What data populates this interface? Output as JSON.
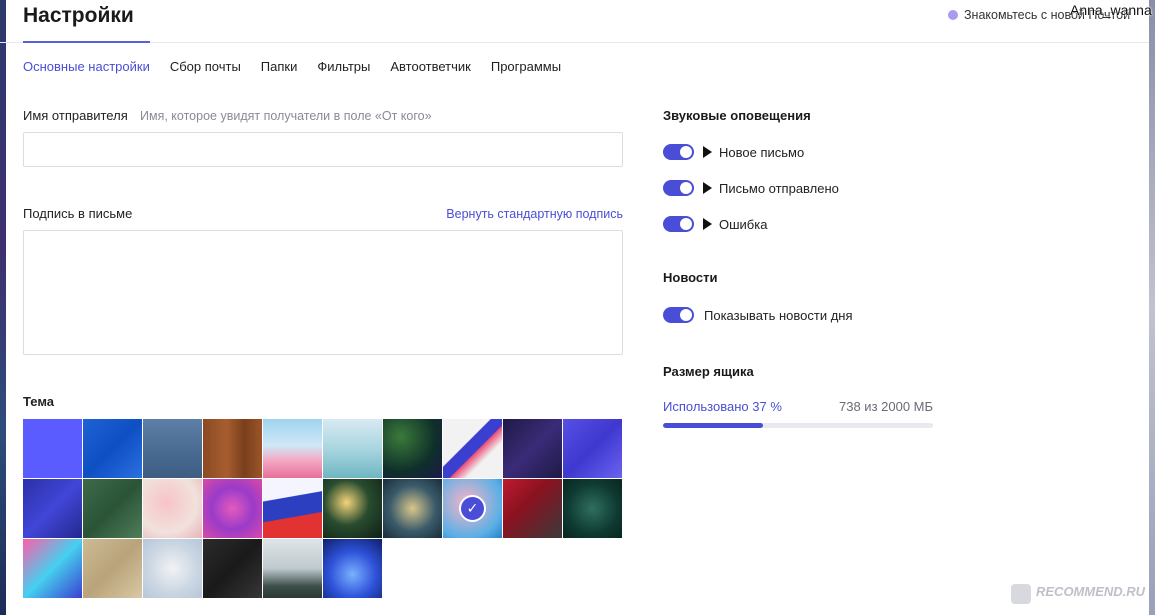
{
  "header": {
    "title": "Настройки",
    "promo_text": "Знакомьтесь с новой Почтой",
    "username": "Anna_wanna"
  },
  "tabs": [
    {
      "label": "Основные настройки",
      "active": true
    },
    {
      "label": "Сбор почты",
      "active": false
    },
    {
      "label": "Папки",
      "active": false
    },
    {
      "label": "Фильтры",
      "active": false
    },
    {
      "label": "Автоответчик",
      "active": false
    },
    {
      "label": "Программы",
      "active": false
    }
  ],
  "sender": {
    "label": "Имя отправителя",
    "hint": "Имя, которое увидят получатели в поле «От кого»",
    "value": ""
  },
  "signature": {
    "label": "Подпись в письме",
    "reset_link": "Вернуть стандартную подпись",
    "value": ""
  },
  "theme": {
    "label": "Тема",
    "selected_index": 17,
    "tiles": [
      {
        "name": "solid-blue",
        "bg": "#5b5cff"
      },
      {
        "name": "blue-knit",
        "bg": "linear-gradient(135deg,#1f62d6,#0f4fc4 50%,#2a70e0)"
      },
      {
        "name": "denim",
        "bg": "linear-gradient(180deg,#5d7fa8,#48698f 60%,#3f5d82)"
      },
      {
        "name": "wood",
        "bg": "linear-gradient(90deg,#8a4a23,#a85d30 40%,#7a3f1c 70%,#9c5428)"
      },
      {
        "name": "pink-flowers-sky",
        "bg": "linear-gradient(180deg,#9fd3ef 0%,#cfe8f6 45%,#f3a9c4 70%,#e86f9a 100%)"
      },
      {
        "name": "misty-lake",
        "bg": "linear-gradient(180deg,#d7e9f2,#a9d6df 50%,#6fb6c2)"
      },
      {
        "name": "tropical-leaves",
        "bg": "radial-gradient(circle at 30% 30%,#3a7a3a,#0f2f2a 60%,#1a1a4a)"
      },
      {
        "name": "geometric-triangles",
        "bg": "linear-gradient(135deg,#f2f2f2 0%,#f2f2f2 40%,#3b3fd0 41%,#3b3fd0 55%,#e94e77 56%,#f2f2f2 70%)"
      },
      {
        "name": "lightning-pattern",
        "bg": "linear-gradient(135deg,#1e1a45,#3b2b78 50%,#1e1a45)"
      },
      {
        "name": "blue-triangles",
        "bg": "linear-gradient(135deg,#5650e6,#3e38cf 50%,#6a63f0)"
      },
      {
        "name": "gift-boxes",
        "bg": "linear-gradient(135deg,#2b2fa8,#4146d6 50%,#232890)"
      },
      {
        "name": "green-stars",
        "bg": "linear-gradient(135deg,#3d6a4a,#2b5437 50%,#4f7d5a)"
      },
      {
        "name": "roses",
        "bg": "radial-gradient(circle at 40% 40%,#f7c4c8,#f1e1dc 60%,#e7b3b8)"
      },
      {
        "name": "purple-flowers",
        "bg": "radial-gradient(circle at 50% 50%,#e35bbd,#9a3bc9 50%,#d94aa6)"
      },
      {
        "name": "russian-flag",
        "bg": "linear-gradient(170deg,#f5f5ff 0%,#f5f5ff 32%,#2b3fc0 33%,#2b3fc0 62%,#e23232 63%,#e23232 100%)"
      },
      {
        "name": "christmas-bokeh",
        "bg": "radial-gradient(circle at 40% 40%,#f4d47a,#294c2f 45%,#0e1f15)"
      },
      {
        "name": "bokeh-lights",
        "bg": "radial-gradient(circle at 50% 50%,#d9c78a,#3a5a6a 55%,#1a2e3a)"
      },
      {
        "name": "pink-pig",
        "bg": "radial-gradient(circle at 40% 40%,#f6b3c8,#5ab0e6 70%,#2a7ec9)"
      },
      {
        "name": "red-gifts",
        "bg": "linear-gradient(135deg,#c01a2f,#8a1220 40%,#3a3a3a)"
      },
      {
        "name": "pine-branches",
        "bg": "radial-gradient(circle at 50% 50%,#2f6f5f,#0f3a32 60%,#08261f)"
      },
      {
        "name": "fireworks",
        "bg": "linear-gradient(135deg,#ff5ea8,#45d0f0 50%,#3b3fd0)"
      },
      {
        "name": "starfish-sand",
        "bg": "linear-gradient(135deg,#cdbb95,#b9a37a 50%,#d8c8a4)"
      },
      {
        "name": "white-blossom",
        "bg": "radial-gradient(circle at 50% 50%,#f2f2f4,#c9d5e2 60%,#b6c7d8)"
      },
      {
        "name": "dark-stone",
        "bg": "linear-gradient(135deg,#2b2b2b,#1a1a1a 50%,#363636)"
      },
      {
        "name": "misty-mountains",
        "bg": "linear-gradient(180deg,#dfe5e8 0%,#bfc9ce 50%,#3d4f4a 80%,#2a3a35 100%)"
      },
      {
        "name": "jellyfish",
        "bg": "radial-gradient(circle at 50% 60%,#7ab0ff,#2e52d9 50%,#0e1f6a)"
      }
    ]
  },
  "sounds": {
    "title": "Звуковые оповещения",
    "items": [
      {
        "label": "Новое письмо",
        "enabled": true
      },
      {
        "label": "Письмо отправлено",
        "enabled": true
      },
      {
        "label": "Ошибка",
        "enabled": true
      }
    ]
  },
  "news": {
    "title": "Новости",
    "toggle_label": "Показывать новости дня",
    "enabled": true
  },
  "mailbox": {
    "title": "Размер ящика",
    "used_label": "Использовано 37 %",
    "used_amount": "738 из 2000 МБ",
    "used_fraction": 0.37
  },
  "watermark": {
    "text": "RECOMMEND.RU"
  },
  "colors": {
    "accent": "#4a4ed6",
    "promo_dot": "#a89bf2"
  }
}
